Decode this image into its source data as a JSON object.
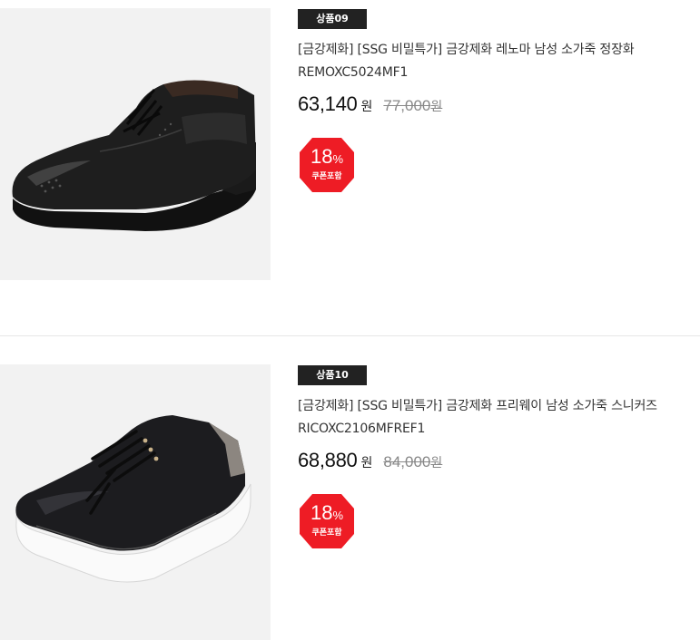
{
  "products": [
    {
      "tag": "상품09",
      "name": "[금강제화] [SSG 비밀특가] 금강제화 레노마 남성 소가죽 정장화 REMOXC5024MF1",
      "price": "63,140",
      "price_unit": "원",
      "original_price": "77,000",
      "original_unit": "원",
      "discount_value": "18",
      "discount_unit": "%",
      "discount_note": "쿠폰포함",
      "image_icon": "oxford-shoe-image"
    },
    {
      "tag": "상품10",
      "name": "[금강제화] [SSG 비밀특가] 금강제화 프리웨이 남성 소가죽 스니커즈 RICOXC2106MFREF1",
      "price": "68,880",
      "price_unit": "원",
      "original_price": "84,000",
      "original_unit": "원",
      "discount_value": "18",
      "discount_unit": "%",
      "discount_note": "쿠폰포함",
      "image_icon": "sneaker-image"
    }
  ],
  "colors": {
    "badge_red": "#ee1c25",
    "tag_bg": "#222222",
    "strike_gray": "#888888"
  }
}
